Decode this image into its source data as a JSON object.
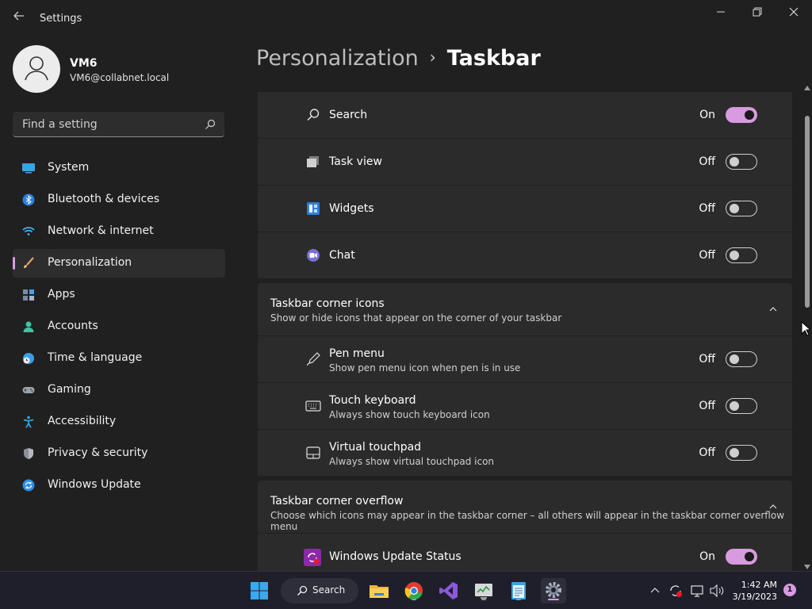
{
  "window": {
    "title": "Settings",
    "minimize": "—",
    "restore": "❐",
    "close": "✕"
  },
  "profile": {
    "name": "VM6",
    "email": "VM6@collabnet.local"
  },
  "search": {
    "placeholder": "Find a setting"
  },
  "nav": [
    {
      "label": "System",
      "icon": "monitor-icon"
    },
    {
      "label": "Bluetooth & devices",
      "icon": "bluetooth-icon"
    },
    {
      "label": "Network & internet",
      "icon": "wifi-icon"
    },
    {
      "label": "Personalization",
      "icon": "brush-icon",
      "active": true
    },
    {
      "label": "Apps",
      "icon": "apps-icon"
    },
    {
      "label": "Accounts",
      "icon": "person-icon"
    },
    {
      "label": "Time & language",
      "icon": "clock-globe-icon"
    },
    {
      "label": "Gaming",
      "icon": "gamepad-icon"
    },
    {
      "label": "Accessibility",
      "icon": "accessibility-icon"
    },
    {
      "label": "Privacy & security",
      "icon": "shield-icon"
    },
    {
      "label": "Windows Update",
      "icon": "sync-icon"
    }
  ],
  "breadcrumb": {
    "parent": "Personalization",
    "separator": "›",
    "current": "Taskbar"
  },
  "taskbar_items": [
    {
      "label": "Search",
      "state": "On",
      "on": true,
      "icon": "search-icon"
    },
    {
      "label": "Task view",
      "state": "Off",
      "on": false,
      "icon": "task-view-icon"
    },
    {
      "label": "Widgets",
      "state": "Off",
      "on": false,
      "icon": "widgets-icon"
    },
    {
      "label": "Chat",
      "state": "Off",
      "on": false,
      "icon": "chat-icon"
    }
  ],
  "corner_icons": {
    "title": "Taskbar corner icons",
    "description": "Show or hide icons that appear on the corner of your taskbar",
    "items": [
      {
        "label": "Pen menu",
        "description": "Show pen menu icon when pen is in use",
        "state": "Off",
        "on": false,
        "icon": "pen-icon"
      },
      {
        "label": "Touch keyboard",
        "description": "Always show touch keyboard icon",
        "state": "Off",
        "on": false,
        "icon": "keyboard-icon"
      },
      {
        "label": "Virtual touchpad",
        "description": "Always show virtual touchpad icon",
        "state": "Off",
        "on": false,
        "icon": "touchpad-icon"
      }
    ]
  },
  "corner_overflow": {
    "title": "Taskbar corner overflow",
    "description": "Choose which icons may appear in the taskbar corner – all others will appear in the taskbar corner overflow menu",
    "items": [
      {
        "label": "Windows Update Status",
        "state": "On",
        "on": true,
        "icon": "windows-update-status-icon"
      }
    ]
  },
  "taskbar": {
    "search_label": "Search",
    "time": "1:42 AM",
    "date": "3/19/2023",
    "notification_count": "1",
    "pinned": [
      "start-icon",
      "file-explorer-icon",
      "chrome-icon",
      "visual-studio-icon",
      "task-manager-icon",
      "notepad-icon",
      "settings-icon"
    ]
  },
  "colors": {
    "accent": "#d89be0",
    "background": "#202020",
    "card": "#2b2b2b"
  }
}
